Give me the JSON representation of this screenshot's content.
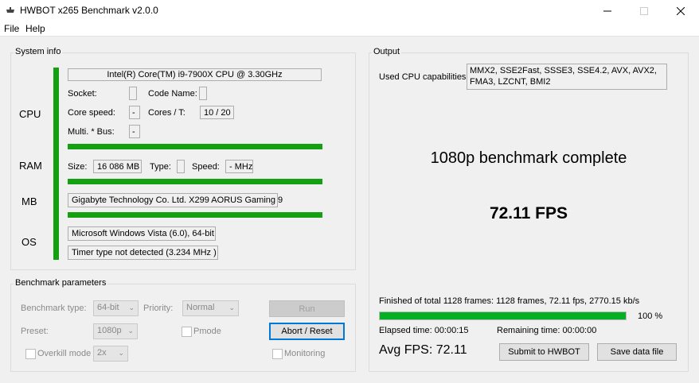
{
  "window": {
    "title": "HWBOT x265 Benchmark v2.0.0"
  },
  "menu": {
    "file": "File",
    "help": "Help"
  },
  "system_info": {
    "title": "System info",
    "cpu_label": "CPU",
    "cpu_name": "Intel(R) Core(TM) i9-7900X CPU @ 3.30GHz",
    "socket_label": "Socket:",
    "socket_value": "",
    "codename_label": "Code Name:",
    "codename_value": "",
    "core_speed_label": "Core speed:",
    "core_speed_value": "-",
    "cores_label": "Cores / T:",
    "cores_value": "10 / 20",
    "multi_label": "Multi. * Bus:",
    "multi_value": "-",
    "ram_label": "RAM",
    "ram_size_label": "Size:",
    "ram_size_value": "16 086 MB",
    "ram_type_label": "Type:",
    "ram_type_value": "",
    "ram_speed_label": "Speed:",
    "ram_speed_value": "- MHz",
    "mb_label": "MB",
    "mb_value": "Gigabyte Technology Co. Ltd. X299 AORUS Gaming 9",
    "os_label": "OS",
    "os_value": "Microsoft Windows Vista (6.0), 64-bit",
    "timer_value": "Timer type not detected (3.234 MHz )"
  },
  "benchmark_params": {
    "title": "Benchmark parameters",
    "type_label": "Benchmark type:",
    "type_value": "64-bit",
    "priority_label": "Priority:",
    "priority_value": "Normal",
    "run_label": "Run",
    "preset_label": "Preset:",
    "preset_value": "1080p",
    "pmode_label": "Pmode",
    "abort_label": "Abort / Reset",
    "overkill_label": "Overkill mode",
    "overkill_value": "2x",
    "monitoring_label": "Monitoring"
  },
  "output": {
    "title": "Output",
    "cpu_caps_label": "Used CPU capabilities:",
    "cpu_caps_value": "MMX2, SSE2Fast, SSSE3, SSE4.2, AVX, AVX2, FMA3, LZCNT, BMI2",
    "status": "1080p benchmark complete",
    "fps": "72.11 FPS",
    "finished_text": "Finished of total 1128 frames: 1128 frames, 72.11 fps,  2770.15 kb/s",
    "progress_percent": 100,
    "progress_label": "100 %",
    "elapsed": "Elapsed time: 00:00:15",
    "remaining": "Remaining time: 00:00:00",
    "avg_fps": "Avg FPS: 72.11",
    "submit_label": "Submit to HWBOT",
    "save_label": "Save data file"
  },
  "colors": {
    "bar_green": "#14a010",
    "progress_green": "#06b025",
    "accent": "#0078d7"
  }
}
